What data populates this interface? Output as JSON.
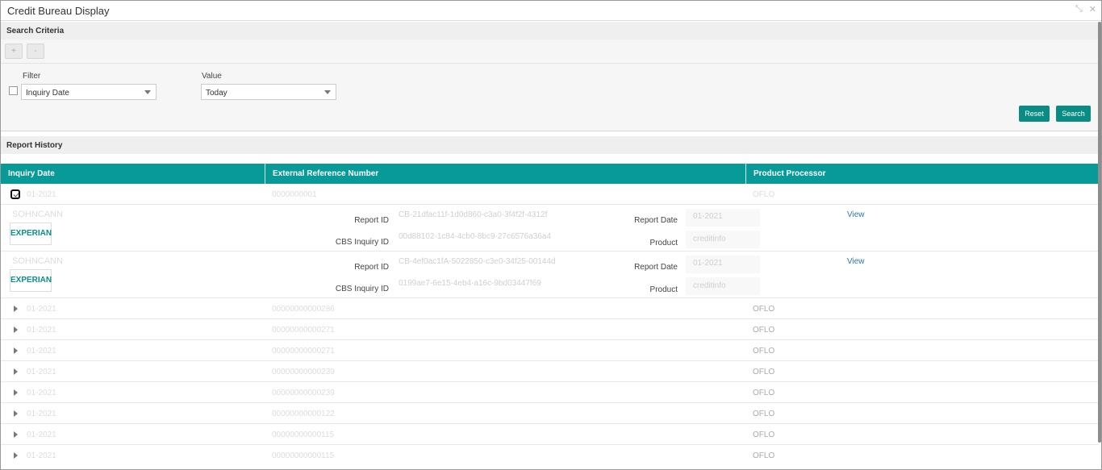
{
  "window": {
    "title": "Credit Bureau Display"
  },
  "search": {
    "section_title": "Search Criteria",
    "filter_label": "Filter",
    "filter_value": "Inquiry Date",
    "value_label": "Value",
    "value_value": "Today",
    "reset_label": "Reset",
    "search_label": "Search",
    "add_label": "+",
    "remove_label": "-"
  },
  "history": {
    "section_title": "Report History",
    "columns": [
      "Inquiry Date",
      "External Reference Number",
      "Product Processor"
    ],
    "first_row": {
      "date": "01-2021",
      "ref": "0000000001",
      "processor": "OFLO"
    },
    "expanded": [
      {
        "applicant": "SOHNCANN",
        "bureau": "EXPERIAN",
        "report_id_label": "Report ID",
        "report_id": "CB-21dfac11f-1d0d860-c3a0-3f4f2f-4312f",
        "cbs_label": "CBS Inquiry ID",
        "cbs": "00d88102-1c84-4cb0-8bc9-27c6576a36a4",
        "report_date_label": "Report Date",
        "report_date": "01-2021",
        "product_label": "Product",
        "product": "creditinfo",
        "view_label": "View"
      },
      {
        "applicant": "SOHNCANN",
        "bureau": "EXPERIAN",
        "report_id_label": "Report ID",
        "report_id": "CB-4ef0ac1fA-5022850-c3e0-34f25-00144d",
        "cbs_label": "CBS Inquiry ID",
        "cbs": "0199ae7-6e15-4eb4-a16c-9bd03447f69",
        "report_date_label": "Report Date",
        "report_date": "01-2021",
        "product_label": "Product",
        "product": "creditinfo",
        "view_label": "View"
      }
    ],
    "rows": [
      {
        "date": "01-2021",
        "ref": "00000000000286",
        "processor": "OFLO"
      },
      {
        "date": "01-2021",
        "ref": "00000000000271",
        "processor": "OFLO"
      },
      {
        "date": "01-2021",
        "ref": "00000000000271",
        "processor": "OFLO"
      },
      {
        "date": "01-2021",
        "ref": "00000000000239",
        "processor": "OFLO"
      },
      {
        "date": "01-2021",
        "ref": "00000000000239",
        "processor": "OFLO"
      },
      {
        "date": "01-2021",
        "ref": "00000000000122",
        "processor": "OFLO"
      },
      {
        "date": "01-2021",
        "ref": "00000000000115",
        "processor": "OFLO"
      },
      {
        "date": "01-2021",
        "ref": "00000000000115",
        "processor": "OFLO"
      }
    ]
  }
}
